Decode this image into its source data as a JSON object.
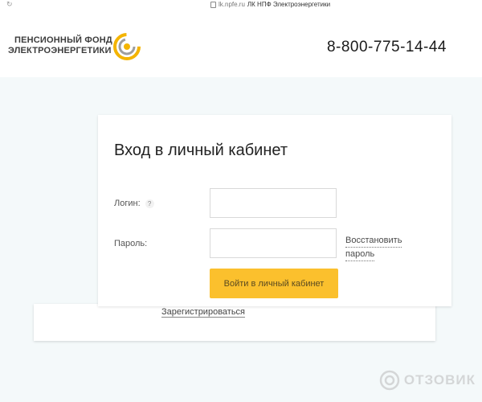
{
  "browser": {
    "url": "lk.npfe.ru",
    "page_title": "ЛК НПФ Электроэнергетики"
  },
  "header": {
    "logo_line1": "ПЕНСИОННЫЙ ФОНД",
    "logo_line2": "ЭЛЕКТРОЭНЕРГЕТИКИ",
    "phone": "8-800-775-14-44"
  },
  "login": {
    "title": "Вход в личный кабинет",
    "login_label": "Логин:",
    "help_mark": "?",
    "password_label": "Пароль:",
    "restore_line1": "Восстановить",
    "restore_line2": "пароль",
    "submit_label": "Войти в личный кабинет",
    "register_label": "Зарегистрироваться"
  },
  "watermark": {
    "text": "ОТЗОВИК"
  },
  "colors": {
    "accent": "#fbc02d",
    "page_background": "#f4f9fa"
  },
  "icons": [
    "lock-icon",
    "npf-logo-icon",
    "help-icon",
    "otzovik-logo-icon"
  ]
}
